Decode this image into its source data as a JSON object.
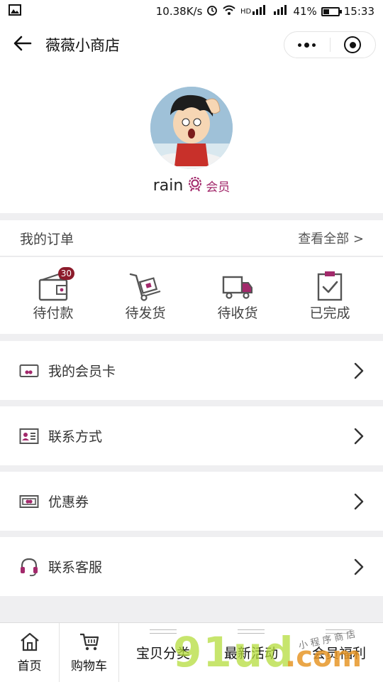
{
  "status_bar": {
    "speed": "10.38K/s",
    "battery": "41%",
    "battery_level": 0.41,
    "time": "15:33"
  },
  "nav": {
    "title": "薇薇小商店"
  },
  "profile": {
    "username": "rain",
    "member_label": "会员"
  },
  "orders": {
    "title": "我的订单",
    "view_all": "查看全部 >",
    "items": [
      {
        "label": "待付款",
        "badge": "30"
      },
      {
        "label": "待发货"
      },
      {
        "label": "待收货"
      },
      {
        "label": "已完成"
      }
    ]
  },
  "menu": [
    {
      "label": "我的会员卡"
    },
    {
      "label": "联系方式"
    },
    {
      "label": "优惠券"
    },
    {
      "label": "联系客服"
    }
  ],
  "tabbar": {
    "items": [
      {
        "label": "首页"
      },
      {
        "label": "购物车"
      },
      {
        "label": "宝贝分类"
      },
      {
        "label": "最新活动"
      },
      {
        "label": "会员福利"
      }
    ]
  },
  "watermark": {
    "text": "91ud",
    "suffix": ".com",
    "small": "小 程 序 商 店"
  },
  "colors": {
    "accent": "#a2296b",
    "badge": "#8c1b2b",
    "icon_dark": "#555555"
  }
}
